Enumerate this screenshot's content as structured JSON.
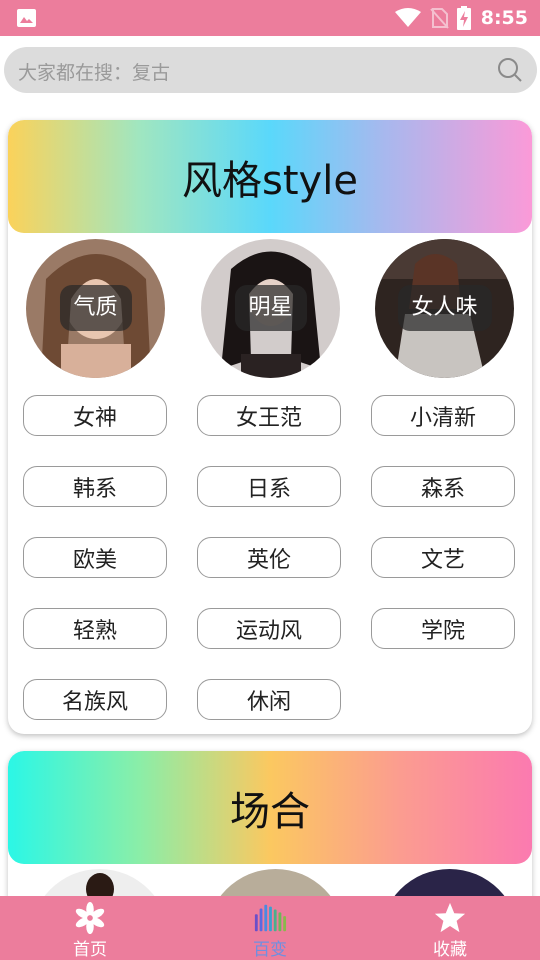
{
  "status_bar": {
    "time": "8:55"
  },
  "search": {
    "placeholder": "大家都在搜：复古"
  },
  "style_section": {
    "title": "风格style",
    "avatars": [
      {
        "label": "气质"
      },
      {
        "label": "明星"
      },
      {
        "label": "女人味"
      }
    ],
    "tags": [
      "女神",
      "女王范",
      "小清新",
      "韩系",
      "日系",
      "森系",
      "欧美",
      "英伦",
      "文艺",
      "轻熟",
      "运动风",
      "学院",
      "名族风",
      "休闲"
    ]
  },
  "occasion_section": {
    "title": "场合"
  },
  "bottom_nav": {
    "items": [
      {
        "label": "首页",
        "active": false
      },
      {
        "label": "百变",
        "active": true
      },
      {
        "label": "收藏",
        "active": false
      }
    ],
    "active_color": "#6f8fe0"
  },
  "colors": {
    "accent": "#ec7d9c",
    "search_bg": "#dcdcdc"
  }
}
